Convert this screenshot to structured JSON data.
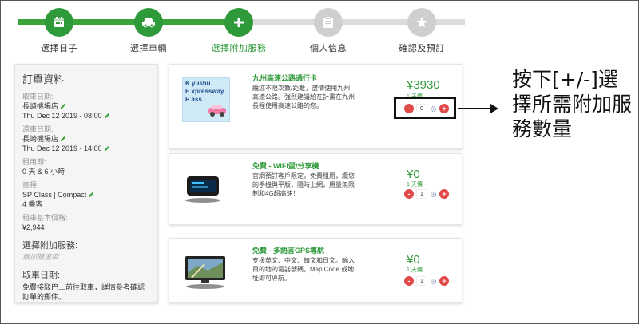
{
  "steps": [
    {
      "label": "選擇日子",
      "icon": "calendar-icon",
      "state": "done"
    },
    {
      "label": "選擇車輛",
      "icon": "car-icon",
      "state": "done"
    },
    {
      "label": "選擇附加服務",
      "icon": "plus-icon",
      "state": "active"
    },
    {
      "label": "個人信息",
      "icon": "clipboard-icon",
      "state": "todo"
    },
    {
      "label": "確認及預訂",
      "icon": "star-icon",
      "state": "todo"
    }
  ],
  "sidebar": {
    "title": "訂單資料",
    "pickup_label": "取車日期:",
    "pickup_place": "長崎機場店",
    "pickup_time": "Thu Dec 12 2019 - 08:00",
    "return_label": "還車日期:",
    "return_place": "長崎機場店",
    "return_time": "Thu Dec 12 2019 - 14:00",
    "duration_label": "租用期:",
    "duration_value": "0 天 & 6 小時",
    "car_label": "車種:",
    "car_value": "SP Class | Compact",
    "seats_value": "4 乘客",
    "base_price_label": "租車基本價格:",
    "base_price_value": "¥2,944",
    "extras_label": "選擇附加服務:",
    "extras_value": "無加購選項",
    "pickup_info_label": "取車日期:",
    "pickup_info_note": "免費接駁巴士前往取車，詳情參考確認訂單的郵件。"
  },
  "services": [
    {
      "name": "九州高速公路通行卡",
      "desc": "纜您不限次數/距離，盡情使用九州高速公路。強烈建議給在計畫在九州長程使用高速公路的您。",
      "price": "¥3930",
      "unit": "1 天價",
      "qty": "0",
      "image": "kyushu-expressway-pass-image",
      "logo_lines": [
        "K yushu",
        "E xpressway",
        "P ass"
      ]
    },
    {
      "name": "免費 - WiFi蛋/分享機",
      "desc": "官網預訂客戶限定，免費租用，纜您的手機與平版，隨時上網，用量無限制和4G超高速！",
      "price": "¥0",
      "unit": "1 天價",
      "qty": "1",
      "image": "wifi-router-image"
    },
    {
      "name": "免費 - 多語言GPS導航",
      "desc": "支援英文、中文、韓文和日文。輸入目的地的電話號碼，Map Code 或地址即可導航。",
      "price": "¥0",
      "unit": "1 天價",
      "qty": "1",
      "image": "gps-navigator-image"
    }
  ],
  "annotation": "按下[+/-]選擇所需附加服務數量",
  "colors": {
    "accent_green": "#2f9a3a",
    "stepper_red": "#e24a4a",
    "inactive_grey": "#cfcfcf"
  }
}
